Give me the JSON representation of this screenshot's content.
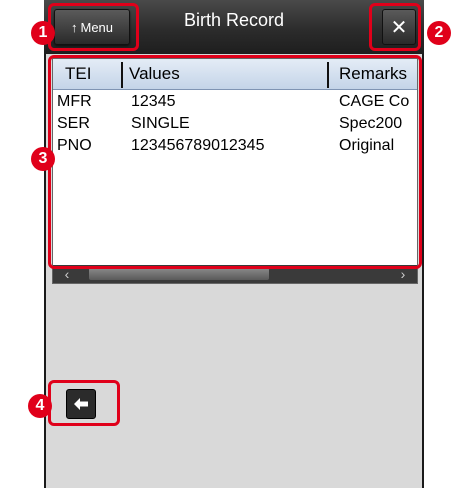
{
  "header": {
    "title": "Birth Record",
    "menu_label": "Menu",
    "menu_icon": "up-arrow-icon",
    "close_label": "✕"
  },
  "table": {
    "columns": [
      "TEI",
      "Values",
      "Remarks"
    ],
    "rows": [
      {
        "tei": "MFR",
        "value": "12345",
        "remark": "CAGE Co"
      },
      {
        "tei": "SER",
        "value": "SINGLE",
        "remark": "Spec200"
      },
      {
        "tei": "PNO",
        "value": "123456789012345",
        "remark": "Original"
      }
    ]
  },
  "callouts": [
    "1",
    "2",
    "3",
    "4"
  ],
  "colors": {
    "callout": "#e0001a",
    "header": "#c4d4e8"
  }
}
